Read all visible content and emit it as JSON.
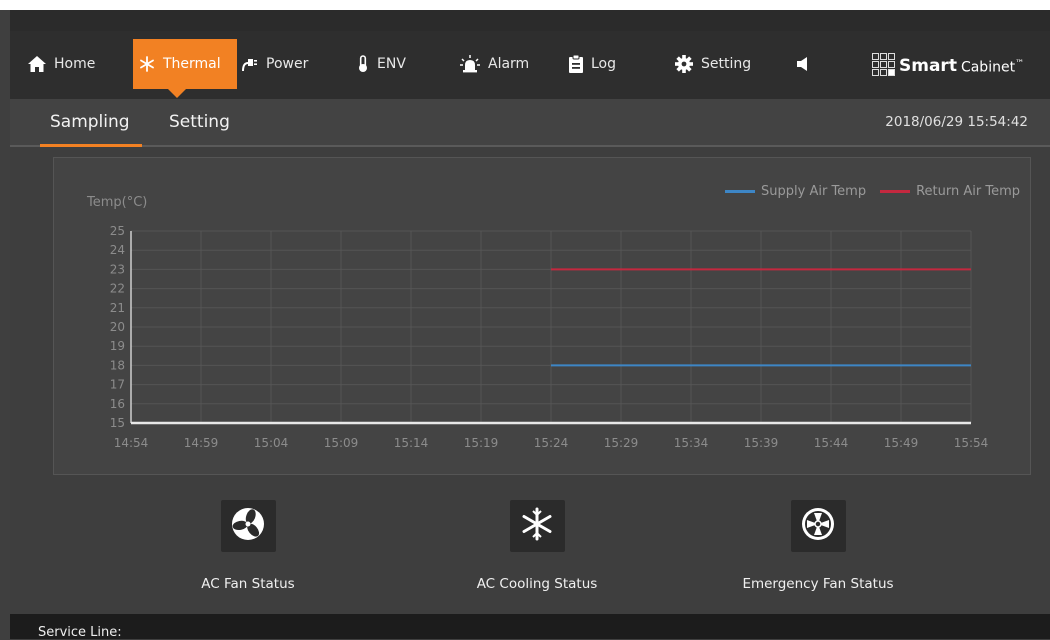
{
  "nav": {
    "items": [
      {
        "label": "Home",
        "icon": "home-icon"
      },
      {
        "label": "Thermal",
        "icon": "snowflake-icon"
      },
      {
        "label": "Power",
        "icon": "power-plug-icon"
      },
      {
        "label": "ENV",
        "icon": "thermometer-icon"
      },
      {
        "label": "Alarm",
        "icon": "alarm-light-icon"
      },
      {
        "label": "Log",
        "icon": "clipboard-icon"
      },
      {
        "label": "Setting",
        "icon": "gear-icon"
      },
      {
        "label": "",
        "icon": "speaker-icon"
      }
    ],
    "active": "Thermal",
    "accent_color": "#f28123"
  },
  "brand": {
    "bold": "Smart",
    "rest": "Cabinet",
    "tm": "™"
  },
  "tabs": [
    {
      "label": "Sampling"
    },
    {
      "label": "Setting"
    }
  ],
  "active_tab": "Sampling",
  "datetime": "2018/06/29 15:54:42",
  "chart_data": {
    "type": "line",
    "ylabel": "Temp(°C)",
    "ylim": [
      15,
      25
    ],
    "yticks": [
      "25",
      "24",
      "23",
      "22",
      "21",
      "20",
      "19",
      "18",
      "17",
      "16",
      "15"
    ],
    "categories": [
      "14:54",
      "14:59",
      "15:04",
      "15:09",
      "15:14",
      "15:19",
      "15:24",
      "15:29",
      "15:34",
      "15:39",
      "15:44",
      "15:49",
      "15:54"
    ],
    "grid": true,
    "legend_position": "top-right",
    "series": [
      {
        "name": "Supply Air Temp",
        "color": "#3d86c6",
        "x": [
          "15:24",
          "15:54"
        ],
        "values": [
          18,
          18
        ]
      },
      {
        "name": "Return Air Temp",
        "color": "#c4283f",
        "x": [
          "15:24",
          "15:54"
        ],
        "values": [
          23,
          23
        ]
      }
    ]
  },
  "statuses": [
    {
      "label": "AC Fan Status",
      "icon": "fan-icon"
    },
    {
      "label": "AC Cooling Status",
      "icon": "snowflake-icon"
    },
    {
      "label": "Emergency Fan Status",
      "icon": "emergency-fan-icon"
    }
  ],
  "footer": {
    "text": "Service Line:"
  }
}
